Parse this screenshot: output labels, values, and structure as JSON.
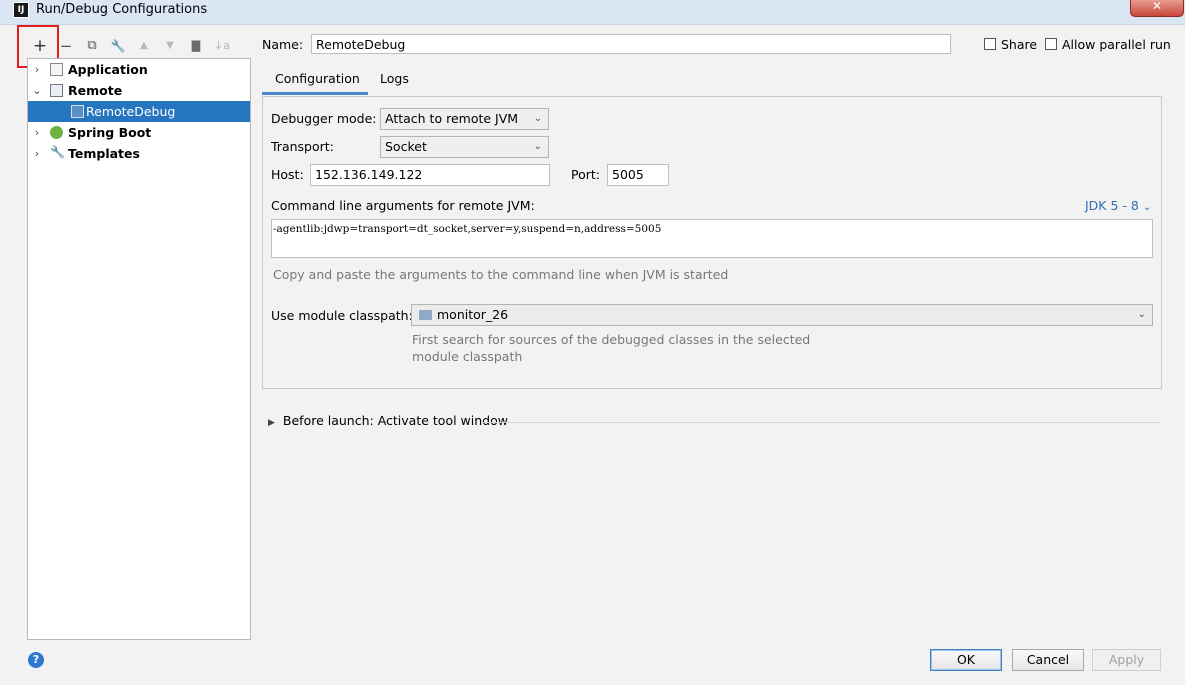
{
  "window": {
    "title": "Run/Debug Configurations",
    "logo_text": "IJ",
    "close_label": "✕"
  },
  "toolbar": {
    "add": "+",
    "remove": "−",
    "copy": "⧉",
    "edit_defaults": "🔧",
    "move_up": "▲",
    "move_down": "▼",
    "new_folder": "▇",
    "sort": "↓a"
  },
  "tree": {
    "items": [
      {
        "label": "Application",
        "arrow": "›"
      },
      {
        "label": "Remote",
        "arrow": "⌄"
      },
      {
        "label": "RemoteDebug"
      },
      {
        "label": "Spring Boot",
        "arrow": "›"
      },
      {
        "label": "Templates",
        "arrow": "›"
      }
    ]
  },
  "name": {
    "label": "Name:",
    "value": "RemoteDebug"
  },
  "share": {
    "label": "Share"
  },
  "parallel": {
    "label": "Allow parallel run"
  },
  "tabs": [
    {
      "label": "Configuration"
    },
    {
      "label": "Logs"
    }
  ],
  "config": {
    "debugger_mode": {
      "label": "Debugger mode:",
      "value": "Attach to remote JVM"
    },
    "transport": {
      "label": "Transport:",
      "value": "Socket"
    },
    "host": {
      "label": "Host:",
      "value": "152.136.149.122"
    },
    "port": {
      "label": "Port:",
      "value": "5005"
    },
    "cmd": {
      "label": "Command line arguments for remote JVM:",
      "jdk": "JDK 5 - 8",
      "value": "-agentlib:jdwp=transport=dt_socket,server=y,suspend=n,address=5005",
      "hint": "Copy and paste the arguments to the command line when JVM is started"
    },
    "module": {
      "label": "Use module classpath:",
      "value": "monitor_26",
      "hint_line1": "First search for sources of the debugged classes in the selected",
      "hint_line2": "module classpath"
    }
  },
  "before_launch": {
    "label": "Before launch: Activate tool window"
  },
  "buttons": {
    "ok": "OK",
    "cancel": "Cancel",
    "apply": "Apply"
  },
  "help": {
    "label": "?"
  },
  "colors": {
    "selection": "#2675bf",
    "accent": "#4a88c7",
    "highlight_box": "#e02020",
    "link": "#2f6fb5"
  }
}
